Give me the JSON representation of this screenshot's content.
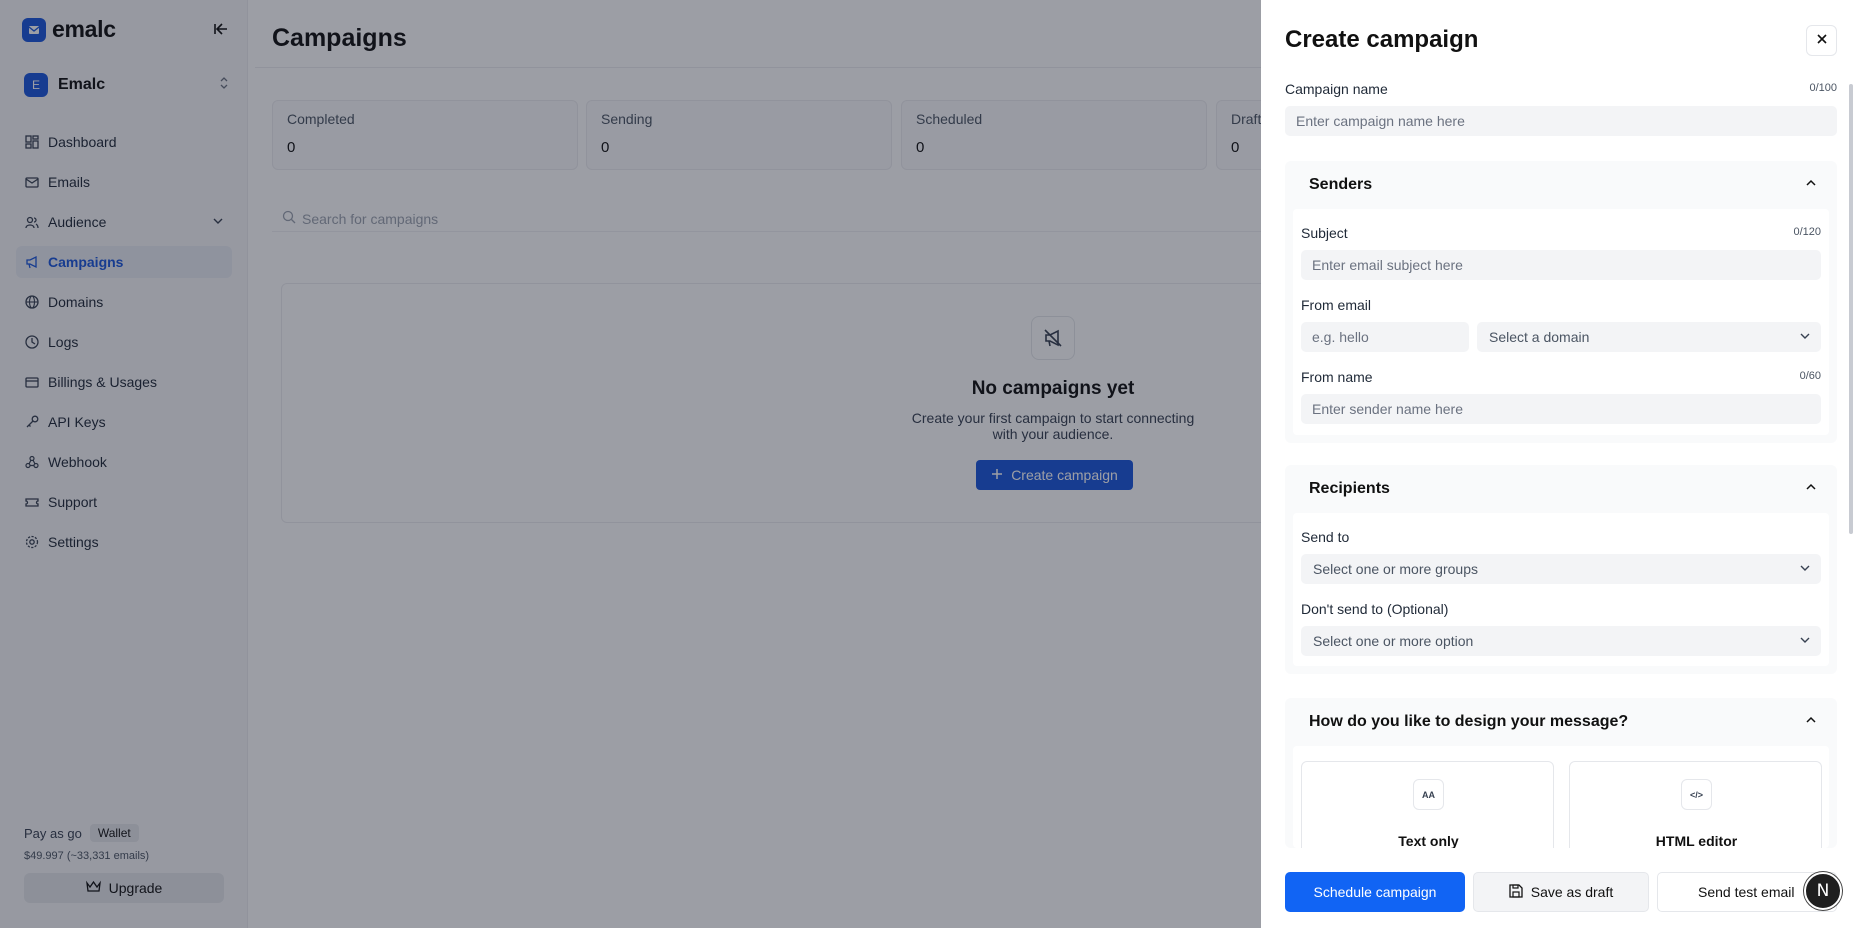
{
  "app": {
    "brand_name": "emalc",
    "workspace": {
      "initial": "E",
      "name": "Emalc"
    },
    "nav": [
      {
        "label": "Dashboard",
        "icon": "dashboard-icon"
      },
      {
        "label": "Emails",
        "icon": "mail-icon"
      },
      {
        "label": "Audience",
        "icon": "users-icon"
      },
      {
        "label": "Campaigns",
        "icon": "megaphone-icon",
        "active": true
      },
      {
        "label": "Domains",
        "icon": "globe-icon"
      },
      {
        "label": "Logs",
        "icon": "clock-icon"
      },
      {
        "label": "Billings & Usages",
        "icon": "card-icon"
      },
      {
        "label": "API Keys",
        "icon": "key-icon"
      },
      {
        "label": "Webhook",
        "icon": "webhook-icon"
      },
      {
        "label": "Support",
        "icon": "ticket-icon"
      },
      {
        "label": "Settings",
        "icon": "gear-icon"
      }
    ],
    "plan": {
      "name": "Pay as go",
      "badge": "Wallet",
      "balance": "$49.997 (~33,331 emails)",
      "upgrade_label": "Upgrade"
    },
    "accent_color": "#1a56db"
  },
  "main": {
    "title": "Campaigns",
    "stats": [
      {
        "label": "Completed",
        "value": "0"
      },
      {
        "label": "Sending",
        "value": "0"
      },
      {
        "label": "Scheduled",
        "value": "0"
      },
      {
        "label": "Draft",
        "value": "0"
      }
    ],
    "search_placeholder": "Search for campaigns",
    "empty": {
      "title": "No campaigns yet",
      "text": "Create your first campaign to start connecting with your audience.",
      "button_label": "Create campaign"
    }
  },
  "drawer": {
    "title": "Create campaign",
    "campaign_name": {
      "label": "Campaign name",
      "counter": "0/100",
      "placeholder": "Enter campaign name here"
    },
    "senders": {
      "title": "Senders",
      "subject": {
        "label": "Subject",
        "counter": "0/120",
        "placeholder": "Enter email subject here"
      },
      "from_email": {
        "label": "From email",
        "placeholder": "e.g. hello",
        "domain_placeholder": "Select a domain"
      },
      "from_name": {
        "label": "From name",
        "counter": "0/60",
        "placeholder": "Enter sender name here"
      }
    },
    "recipients": {
      "title": "Recipients",
      "send_to": {
        "label": "Send to",
        "placeholder": "Select one or more groups"
      },
      "dont_send_to": {
        "label": "Don't send to (Optional)",
        "placeholder": "Select one or more option"
      }
    },
    "design": {
      "title": "How do you like to design your message?",
      "options": [
        {
          "label": "Text only",
          "icon_text": "AA"
        },
        {
          "label": "HTML editor",
          "icon_text": "</>"
        }
      ]
    },
    "footer": {
      "schedule_label": "Schedule campaign",
      "draft_label": "Save as draft",
      "test_label": "Send test email"
    },
    "floating_badge": "N",
    "primary_color": "#1164f4"
  }
}
